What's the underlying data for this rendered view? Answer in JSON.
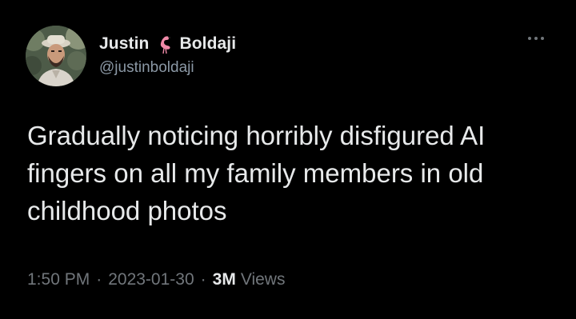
{
  "author": {
    "first_name": "Justin",
    "last_name": "Boldaji",
    "handle": "@justinboldaji",
    "name_emoji_icon": "flamingo-icon"
  },
  "tweet": {
    "text": "Gradually noticing horribly disfigured AI fingers on all my family members in old childhood photos",
    "time": "1:50 PM",
    "date": "2023-01-30",
    "views_count": "3M",
    "views_label": "Views",
    "separator": "·"
  },
  "colors": {
    "background": "#000000",
    "text_primary": "#e7e9ea",
    "text_secondary": "#71767b",
    "flamingo": "#f08aa8"
  },
  "menu_icon": "more-dots-icon"
}
